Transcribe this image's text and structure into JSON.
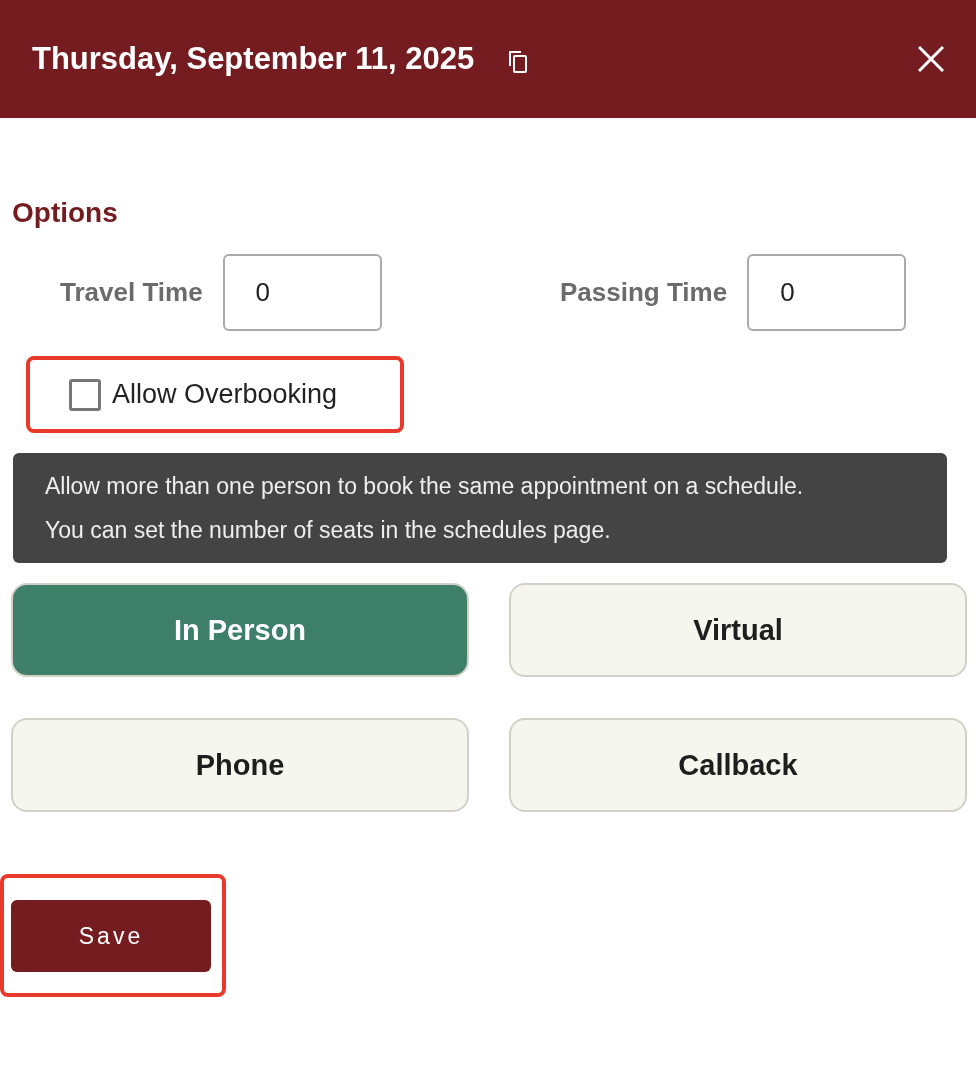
{
  "header": {
    "title": "Thursday, September 11, 2025"
  },
  "options": {
    "heading": "Options",
    "fields": [
      {
        "label": "Travel Time",
        "value": "0"
      },
      {
        "label": "Passing Time",
        "value": "0"
      }
    ],
    "overbooking": {
      "label": "Allow Overbooking",
      "checked": false,
      "highlighted": true
    },
    "tooltip": [
      "Allow more than one person to book the same appointment on a schedule.",
      "You can set the number of seats in the schedules page."
    ]
  },
  "modes": [
    {
      "label": "In Person",
      "selected": true
    },
    {
      "label": "Virtual",
      "selected": false
    },
    {
      "label": "Phone",
      "selected": false
    },
    {
      "label": "Callback",
      "selected": false
    }
  ],
  "save": {
    "label": "Save",
    "highlighted": true
  }
}
